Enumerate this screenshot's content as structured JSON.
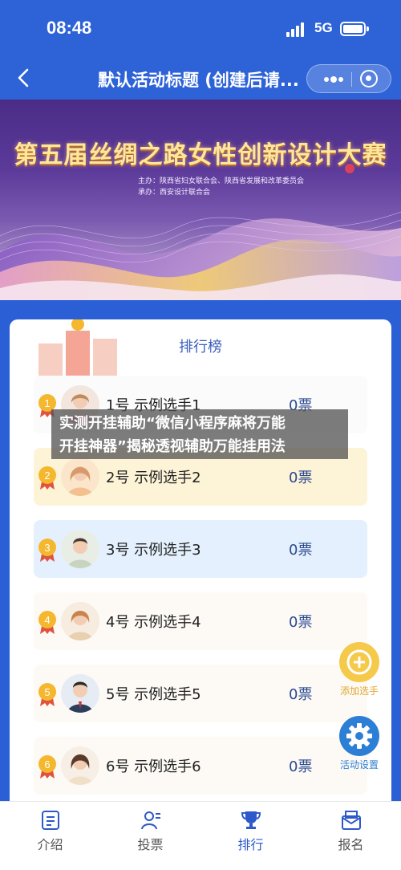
{
  "status_bar": {
    "time": "08:48",
    "network": "5G"
  },
  "nav": {
    "title": "默认活动标题 (创建后请..."
  },
  "banner": {
    "headline": "第五届丝绸之路女性创新设计大赛",
    "org_lines": [
      "主办：陕西省妇女联合会、陕西省发展和改革委员会",
      "承办：西安设计联合会"
    ]
  },
  "ranking": {
    "title": "排行榜",
    "items": [
      {
        "rank": "1",
        "name": "1号 示例选手1",
        "votes": "0票"
      },
      {
        "rank": "2",
        "name": "2号 示例选手2",
        "votes": "0票"
      },
      {
        "rank": "3",
        "name": "3号 示例选手3",
        "votes": "0票"
      },
      {
        "rank": "4",
        "name": "4号 示例选手4",
        "votes": "0票"
      },
      {
        "rank": "5",
        "name": "5号 示例选手5",
        "votes": "0票"
      },
      {
        "rank": "6",
        "name": "6号 示例选手6",
        "votes": "0票"
      }
    ]
  },
  "watermark": {
    "line1": "实测开挂辅助“微信小程序麻将万能",
    "line2": "开挂神器”揭秘透视辅助万能挂用法"
  },
  "floating": {
    "add_label": "添加选手",
    "settings_label": "活动设置"
  },
  "tabs": [
    {
      "label": "介绍",
      "icon": "list-icon"
    },
    {
      "label": "投票",
      "icon": "user-vote-icon"
    },
    {
      "label": "排行",
      "icon": "trophy-icon"
    },
    {
      "label": "报名",
      "icon": "signup-icon"
    }
  ],
  "colors": {
    "primary": "#2e63d8",
    "accent_orange": "#f5b72e",
    "gold_row": "#fdf3d6",
    "blue_row": "#e4f0fd",
    "settings_blue": "#2d7fd6"
  }
}
